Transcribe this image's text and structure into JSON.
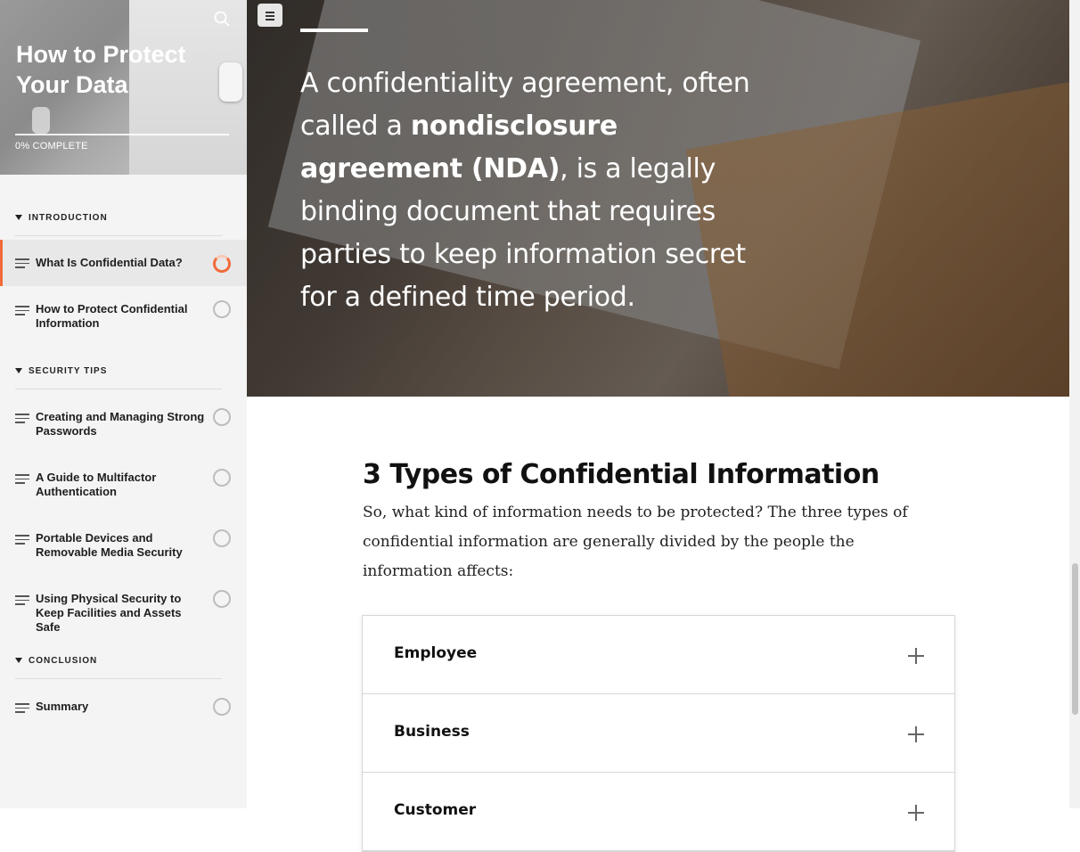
{
  "sidebar": {
    "course_title": "How to Protect Your Data",
    "progress_label": "0% COMPLETE",
    "progress_fraction": 0,
    "search_icon": "search-icon",
    "sections": [
      {
        "label": "INTRODUCTION"
      },
      {
        "label": "SECURITY TIPS"
      },
      {
        "label": "CONCLUSION"
      }
    ],
    "lessons": [
      {
        "title": "What Is Confidential Data?",
        "status": "in-progress"
      },
      {
        "title": "How to Protect Confidential Information",
        "status": "not-started"
      },
      {
        "title": "Creating and Managing Strong Passwords",
        "status": "not-started"
      },
      {
        "title": "A Guide to Multifactor Authentication",
        "status": "not-started"
      },
      {
        "title": "Portable Devices and Removable Media Security",
        "status": "not-started"
      },
      {
        "title": "Using Physical Security to Keep Facilities and Assets Safe",
        "status": "not-started"
      },
      {
        "title": "Summary",
        "status": "not-started"
      }
    ]
  },
  "main": {
    "menu_icon": "hamburger-icon",
    "hero": {
      "quote_before": "A confidentiality agreement, often called a ",
      "quote_bold": "nondisclosure agreement (NDA)",
      "quote_after": ", is a legally binding document that requires parties to keep information secret for a defined time period."
    },
    "section_title": "3 Types of Confidential Information",
    "section_body": "So, what kind of information needs to be protected? The three types of confidential information are generally divided by the people the information affects:",
    "accordion": [
      {
        "label": "Employee"
      },
      {
        "label": "Business"
      },
      {
        "label": "Customer"
      }
    ]
  },
  "colors": {
    "accent": "#f26a3a",
    "sidebar_bg": "#f4f4f4"
  }
}
